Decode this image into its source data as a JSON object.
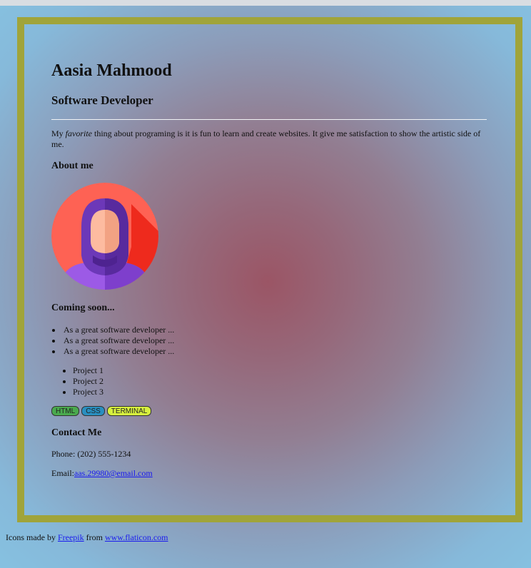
{
  "profile": {
    "name": "Aasia Mahmood",
    "role": "Software Developer",
    "intro_before": "My ",
    "intro_em": "favorite",
    "intro_after": " thing about programing is it is fun to learn and create websites. It give me satisfaction to show the artistic side of me."
  },
  "about": {
    "heading": "About me",
    "avatar_icon": "woman-hijab-avatar-icon"
  },
  "coming_soon": {
    "heading": "Coming soon...",
    "items": [
      "As a great software developer ...",
      "As a great software developer ...",
      "As a great software developer ..."
    ],
    "projects": [
      "Project 1",
      "Project 2",
      "Project 3"
    ]
  },
  "tags": [
    {
      "label": "HTML",
      "color": "#4aaa4e"
    },
    {
      "label": "CSS",
      "color": "#2a8fc0"
    },
    {
      "label": "TERMINAL",
      "color": "#d7f03e"
    }
  ],
  "contact": {
    "heading": "Contact Me",
    "phone": "Phone: (202) 555-1234",
    "email_label": "Email:",
    "email": "aas.29980@email.com"
  },
  "footer": {
    "prefix": "Icons made by ",
    "author": "Freepik",
    "middle": " from ",
    "site": "www.flaticon.com"
  },
  "colors": {
    "frame": "#a0a43a",
    "link": "#1a1aee"
  }
}
